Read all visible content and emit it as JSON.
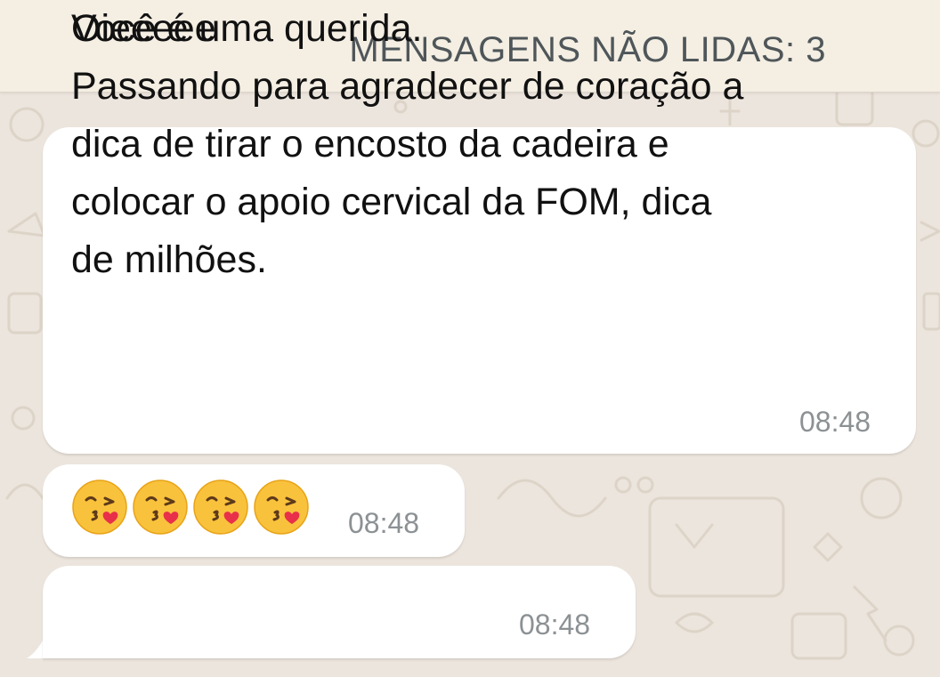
{
  "unread_banner": {
    "label": "MENSAGENS NÃO LIDAS: 3"
  },
  "messages": [
    {
      "lines": [
        "Oieeeee",
        "Passando para agradecer de coração a",
        "dica de tirar o encosto da cadeira e",
        "colocar o apoio cervical da FOM, dica",
        "de milhões."
      ],
      "time": "08:48"
    },
    {
      "emojis": [
        "kissing-heart-emoji",
        "kissing-heart-emoji",
        "kissing-heart-emoji",
        "kissing-heart-emoji"
      ],
      "time": "08:48"
    },
    {
      "text": "Você é uma querida.",
      "time": "08:48"
    }
  ],
  "colors": {
    "background": "#ECE5DD",
    "banner": "#F4EEE3",
    "bubble": "#FFFFFF",
    "timestamp": "#8C9194",
    "banner_text": "#4F5659"
  }
}
